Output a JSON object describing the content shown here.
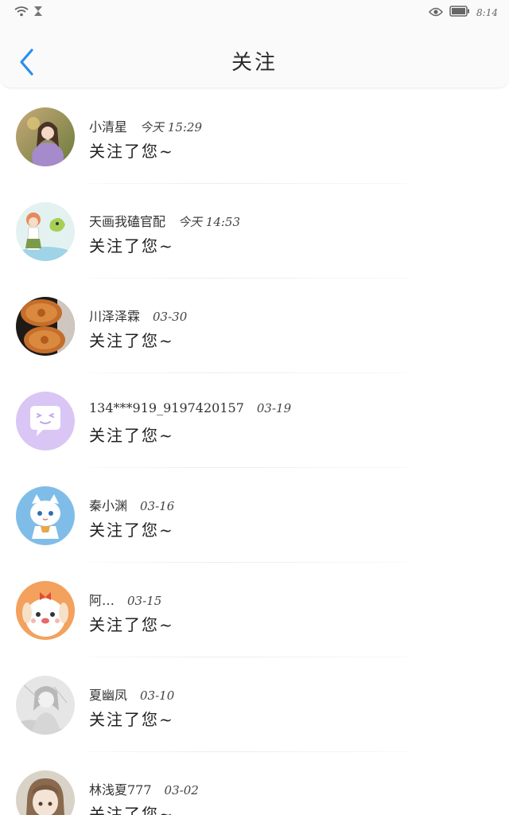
{
  "status_bar": {
    "time": "8:14",
    "icons": [
      "wifi-icon",
      "hourglass-icon",
      "eye-icon",
      "battery-icon"
    ]
  },
  "header": {
    "title": "关注",
    "back_icon": "chevron-left-icon",
    "accent_color": "#2b8fe8"
  },
  "follows": [
    {
      "name": "小清星",
      "time": "今天 15:29",
      "message": "关注了您~",
      "avatar": "photo-girl-purple"
    },
    {
      "name": "天画我磕官配",
      "time": "今天 14:53",
      "message": "关注了您~",
      "avatar": "anime-girl-dragon"
    },
    {
      "name": "川泽泽霖",
      "time": "03-30",
      "message": "关注了您~",
      "avatar": "mooncakes"
    },
    {
      "name": "134***919_9197420157",
      "time": "03-19",
      "message": "关注了您~",
      "avatar": "default-chat-bubble"
    },
    {
      "name": "秦小渊",
      "time": "03-16",
      "message": "关注了您~",
      "avatar": "anime-cat-blue"
    },
    {
      "name": "阿…",
      "time": "03-15",
      "message": "关注了您~",
      "avatar": "cartoon-dog-bow"
    },
    {
      "name": "夏幽凤",
      "time": "03-10",
      "message": "关注了您~",
      "avatar": "sketch-grey"
    },
    {
      "name": "林浅夏777",
      "time": "03-02",
      "message": "关注了您~",
      "avatar": "anime-girl-brown-hair"
    }
  ]
}
